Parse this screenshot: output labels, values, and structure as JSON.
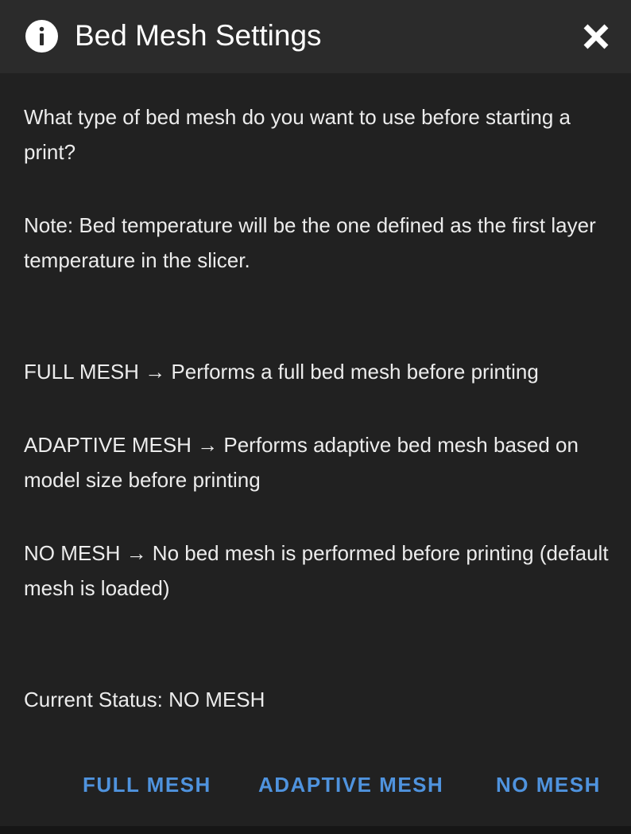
{
  "dialog": {
    "title": "Bed Mesh Settings",
    "info_icon": "info-circle-icon",
    "close_icon": "close-x-icon"
  },
  "body": {
    "question": "What type of bed mesh do you want to use before starting a print?",
    "note": "Note: Bed temperature will be the one defined as the first layer temperature in the slicer.",
    "options": [
      "FULL MESH → Performs a full bed mesh before printing",
      "ADAPTIVE MESH → Performs adaptive bed mesh based on model size before printing",
      "NO MESH → No bed mesh is performed before printing (default mesh is loaded)"
    ],
    "status": "Current Status: NO MESH"
  },
  "actions": {
    "full_mesh": "FULL MESH",
    "adaptive_mesh": "ADAPTIVE MESH",
    "no_mesh": "NO MESH"
  },
  "colors": {
    "background": "#212121",
    "titlebar": "#2b2b2b",
    "text": "#ececec",
    "accent": "#4f93de"
  }
}
